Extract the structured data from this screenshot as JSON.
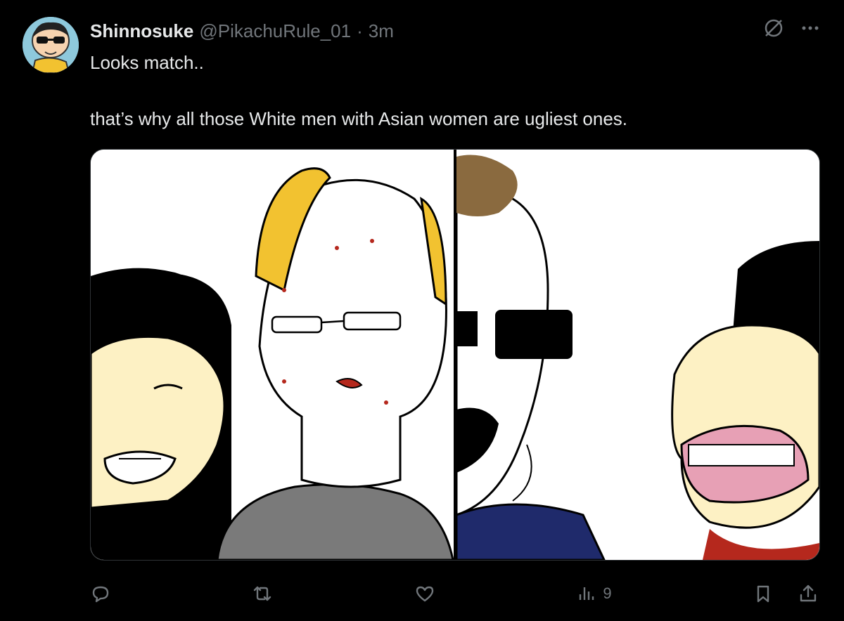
{
  "tweet": {
    "author_name": "Shinnosuke",
    "handle": "@PikachuRule_01",
    "separator": "·",
    "time": "3m",
    "line1": "Looks match..",
    "line2": "that’s why all those White men with Asian women are ugliest ones."
  },
  "actions": {
    "views_count": "9"
  },
  "icons": {
    "reply": "reply-icon",
    "retweet": "retweet-icon",
    "like": "heart-icon",
    "views": "views-icon",
    "bookmark": "bookmark-icon",
    "share": "share-icon",
    "grok": "grok-icon",
    "more": "more-icon"
  },
  "colors": {
    "background": "#000000",
    "text": "#e7e9ea",
    "secondary": "#71767b",
    "border": "#2f3336"
  }
}
